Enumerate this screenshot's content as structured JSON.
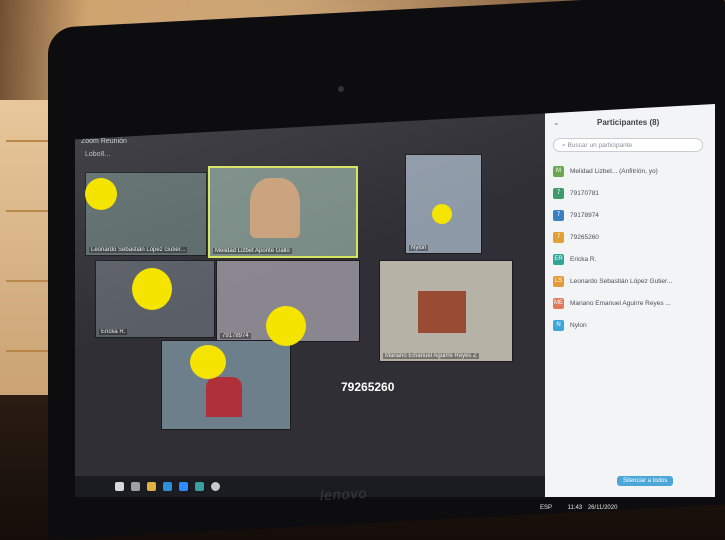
{
  "window": {
    "title": "Zoom Reunión",
    "subtitle": "Lobo8..."
  },
  "grid": {
    "tiles": [
      {
        "name": "Leonardo Sebastián López Gutier...",
        "bg": "#5c6b6a"
      },
      {
        "name": "Melidad Lizbet Aponte Gallo",
        "bg": "#7a8c86"
      },
      {
        "name": "Nylon",
        "bg": "#8f9aa8"
      },
      {
        "name": "Ericka R.",
        "bg": "#5a5e66"
      },
      {
        "name": "79178974",
        "bg": "#8a8690"
      },
      {
        "name": "Mariano Emanuel Aguirre Reyes Z",
        "bg": "#b7b2a6"
      },
      {
        "name": "",
        "bg": "#6e7f8c"
      }
    ],
    "big_label": "79265260"
  },
  "panel": {
    "title": "Participantes (8)",
    "search_placeholder": "Buscar un participante",
    "participants": [
      {
        "initials": "M",
        "name": "Melidad Lizbet... (Anfitrión, yo)",
        "color": "#6aa84f"
      },
      {
        "initials": "7",
        "name": "79170781",
        "color": "#3d9b6b"
      },
      {
        "initials": "7",
        "name": "79178974",
        "color": "#3b7fc0"
      },
      {
        "initials": "7",
        "name": "79265260",
        "color": "#e0a035"
      },
      {
        "initials": "ER",
        "name": "Ericka R.",
        "color": "#2fa59a"
      },
      {
        "initials": "LS",
        "name": "Leonardo Sebastián López Gutier...",
        "color": "#e39a3a"
      },
      {
        "initials": "ME",
        "name": "Mariano Emanuel Aguirre Reyes ...",
        "color": "#e07a5a"
      },
      {
        "initials": "N",
        "name": "Nylon",
        "color": "#3fa7d6"
      }
    ],
    "admit_label": "Silenciar a todos"
  },
  "tray": {
    "lang": "ESP",
    "time": "11:43",
    "date": "26/11/2020"
  },
  "brand": "lenovo"
}
